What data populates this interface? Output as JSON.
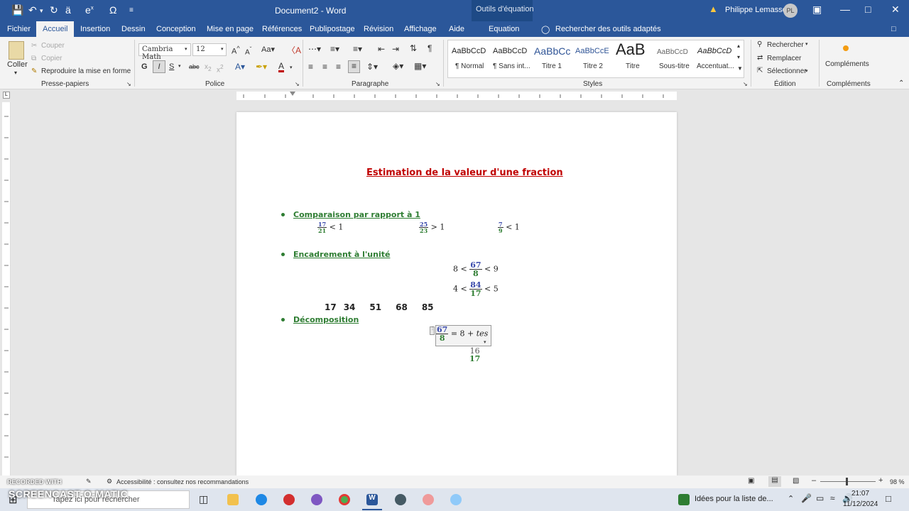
{
  "titlebar": {
    "doc_title": "Document2  -  Word",
    "equation_tools_label": "Outils d'équation",
    "user_name": "Philippe Lemasson",
    "user_initials": "PL"
  },
  "tabs": [
    "Fichier",
    "Accueil",
    "Insertion",
    "Dessin",
    "Conception",
    "Mise en page",
    "Références",
    "Publipostage",
    "Révision",
    "Affichage",
    "Aide"
  ],
  "equation_tab": "Equation",
  "tell_me": "Rechercher des outils adaptés",
  "ribbon": {
    "clipboard": {
      "paste": "Coller",
      "cut": "Couper",
      "copy": "Copier",
      "format_painter": "Reproduire la mise en forme",
      "label": "Presse-papiers"
    },
    "font": {
      "name": "Cambria Math",
      "size": "12",
      "label": "Police"
    },
    "paragraph": {
      "label": "Paragraphe"
    },
    "styles": {
      "label": "Styles",
      "items": [
        {
          "preview": "AaBbCcD",
          "name": "¶ Normal"
        },
        {
          "preview": "AaBbCcD",
          "name": "¶ Sans int..."
        },
        {
          "preview": "AaBbCc",
          "name": "Titre 1"
        },
        {
          "preview": "AaBbCcE",
          "name": "Titre 2"
        },
        {
          "preview": "AaB",
          "name": "Titre"
        },
        {
          "preview": "AaBbCcD",
          "name": "Sous-titre"
        },
        {
          "preview": "AaBbCcD",
          "name": "Accentuat..."
        }
      ]
    },
    "editing": {
      "find": "Rechercher",
      "replace": "Remplacer",
      "select": "Sélectionner",
      "label": "Édition"
    },
    "addins": {
      "button": "Compléments",
      "label": "Compléments"
    }
  },
  "document": {
    "heading": "Estimation de la valeur d'une fraction",
    "sections": [
      "Comparaison par rapport à 1",
      "Encadrement à l'unité",
      "Décomposition"
    ],
    "comparisons": [
      {
        "num": "17",
        "den": "21",
        "op": "< 1"
      },
      {
        "num": "25",
        "den": "23",
        "op": "> 1"
      },
      {
        "num": "7",
        "den": "9",
        "op": "< 1"
      }
    ],
    "encadrements": [
      {
        "left": "8 <",
        "num": "67",
        "den": "8",
        "right": "< 9"
      },
      {
        "left": "4 <",
        "num": "84",
        "den": "17",
        "right": "< 5"
      }
    ],
    "multiples": [
      "17",
      "34",
      "51",
      "68",
      "85"
    ],
    "decomposition": {
      "num": "67",
      "den": "8",
      "rest": "= 8",
      "editing_text": "+ tes",
      "partial_num": "16",
      "partial_den": "17"
    }
  },
  "statusbar": {
    "accessibility": "Accessibilité : consultez nos recommandations",
    "zoom": "98 %"
  },
  "taskbar": {
    "search_placeholder": "Tapez ici pour rechercher",
    "notification": "Idées pour la liste de...",
    "time": "21:07",
    "date": "11/12/2024"
  },
  "watermark": {
    "recorded": "RECORDED WITH",
    "brand": "SCREENCAST-O-MATIC"
  }
}
